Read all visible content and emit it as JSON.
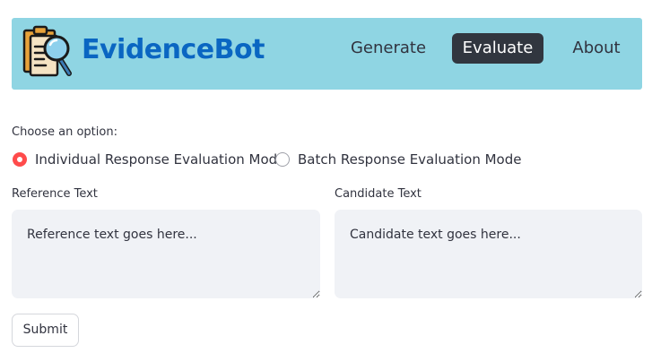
{
  "header": {
    "brand": "EvidenceBot",
    "logo_icon": "document-magnifier-icon",
    "background_color": "#8fd5e3",
    "brand_color": "#0a66c2",
    "nav": [
      {
        "label": "Generate",
        "active": false
      },
      {
        "label": "Evaluate",
        "active": true
      },
      {
        "label": "About",
        "active": false
      }
    ]
  },
  "mode": {
    "label": "Choose an option:",
    "options": [
      {
        "label": "Individual Response Evaluation Mode",
        "selected": true
      },
      {
        "label": "Batch Response Evaluation Mode",
        "selected": false
      }
    ],
    "accent_color": "#ff4b4b"
  },
  "reference": {
    "label": "Reference Text",
    "placeholder": "Reference text goes here...",
    "value": ""
  },
  "candidate": {
    "label": "Candidate Text",
    "placeholder": "Candidate text goes here...",
    "value": ""
  },
  "submit": {
    "label": "Submit"
  }
}
